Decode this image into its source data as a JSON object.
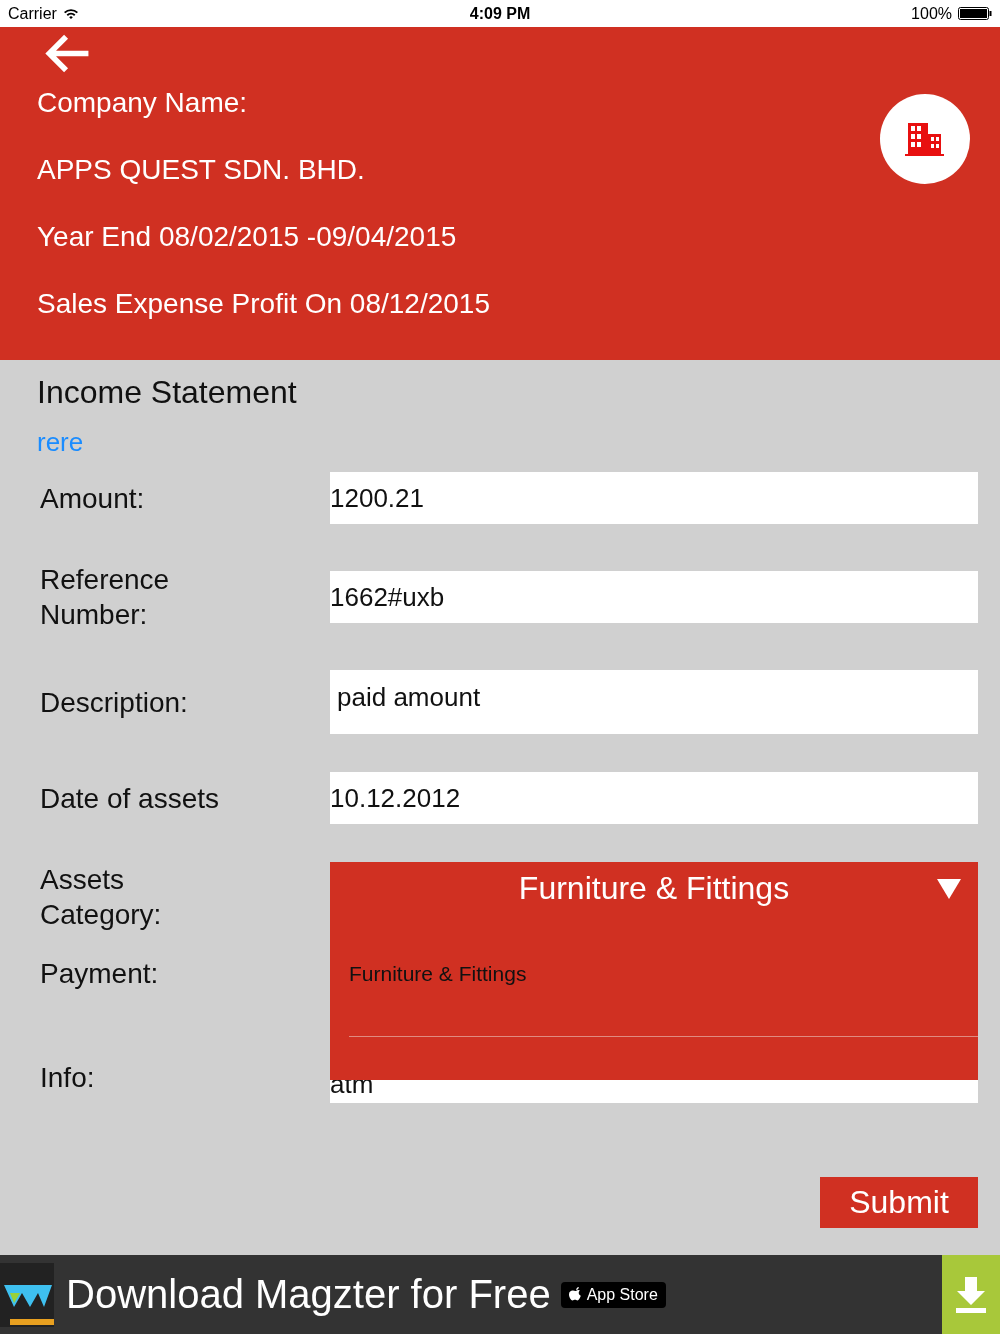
{
  "status_bar": {
    "carrier": "Carrier",
    "time": "4:09 PM",
    "battery": "100%"
  },
  "header": {
    "company_label": "Company Name:",
    "company_name": "APPS QUEST SDN. BHD.",
    "year_end": "Year End 08/02/2015 -09/04/2015",
    "report": "Sales Expense Profit On 08/12/2015"
  },
  "section_title": "Income Statement",
  "link": "rere",
  "fields": [
    {
      "label": "Amount:",
      "value": "1200.21",
      "kind": "text"
    },
    {
      "label": "Reference Number:",
      "value": "1662#uxb",
      "kind": "text"
    },
    {
      "label": "Description:",
      "value": "paid amount",
      "kind": "area"
    },
    {
      "label": "Date of assets",
      "value": "10.12.2012",
      "kind": "text"
    },
    {
      "label": "Assets Category:",
      "kind": "dropdown",
      "value": "Furniture & Fittings",
      "expanded": true,
      "options": [
        "Furniture & Fittings"
      ]
    },
    {
      "label": "Payment:",
      "kind": "hidden"
    },
    {
      "label": "Info:",
      "value": "atm",
      "kind": "text"
    }
  ],
  "submit": "Submit",
  "ad": {
    "text": "Download Magzter for Free",
    "store": "App Store"
  }
}
